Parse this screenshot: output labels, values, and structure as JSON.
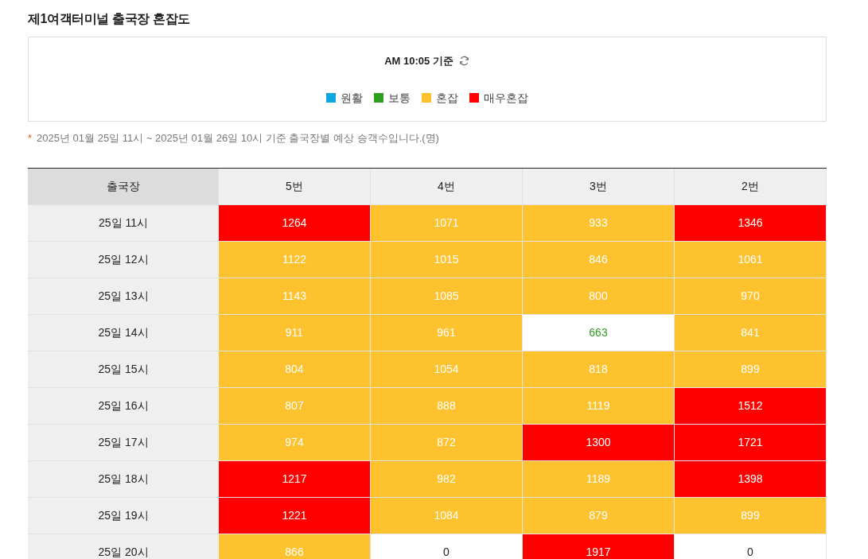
{
  "title": "제1여객터미널 출국장 혼잡도",
  "info_box": {
    "time": "AM 10:05 기준",
    "legend": [
      {
        "label": "원활",
        "color": "#0ea5e0"
      },
      {
        "label": "보통",
        "color": "#2e9e1f"
      },
      {
        "label": "혼잡",
        "color": "#fec22f"
      },
      {
        "label": "매우혼잡",
        "color": "#ff0000"
      }
    ]
  },
  "note_mark": "*",
  "note": "2025년 01월 25일 11시 ~ 2025년 01월 26일 10시 기준 출국장별 예상 승객수입니다.(명)",
  "table": {
    "columns": [
      "출국장",
      "5번",
      "4번",
      "3번",
      "2번"
    ],
    "rows": [
      {
        "cells": [
          {
            "value": "25일 11시",
            "kind": "label"
          },
          {
            "value": "1264",
            "kind": "fill",
            "color": "#ff0000"
          },
          {
            "value": "1071",
            "kind": "fill",
            "color": "#fec22f"
          },
          {
            "value": "933",
            "kind": "fill",
            "color": "#fec22f"
          },
          {
            "value": "1346",
            "kind": "fill",
            "color": "#ff0000"
          }
        ]
      },
      {
        "cells": [
          {
            "value": "25일 12시",
            "kind": "label"
          },
          {
            "value": "1122",
            "kind": "fill",
            "color": "#fec22f"
          },
          {
            "value": "1015",
            "kind": "fill",
            "color": "#fec22f"
          },
          {
            "value": "846",
            "kind": "fill",
            "color": "#fec22f"
          },
          {
            "value": "1061",
            "kind": "fill",
            "color": "#fec22f"
          }
        ]
      },
      {
        "cells": [
          {
            "value": "25일 13시",
            "kind": "label"
          },
          {
            "value": "1143",
            "kind": "fill",
            "color": "#fec22f"
          },
          {
            "value": "1085",
            "kind": "fill",
            "color": "#fec22f"
          },
          {
            "value": "800",
            "kind": "fill",
            "color": "#fec22f"
          },
          {
            "value": "970",
            "kind": "fill",
            "color": "#fec22f"
          }
        ]
      },
      {
        "cells": [
          {
            "value": "25일 14시",
            "kind": "label"
          },
          {
            "value": "911",
            "kind": "fill",
            "color": "#fec22f"
          },
          {
            "value": "961",
            "kind": "fill",
            "color": "#fec22f"
          },
          {
            "value": "663",
            "kind": "text",
            "color": "#2e9e1f"
          },
          {
            "value": "841",
            "kind": "fill",
            "color": "#fec22f"
          }
        ]
      },
      {
        "cells": [
          {
            "value": "25일 15시",
            "kind": "label"
          },
          {
            "value": "804",
            "kind": "fill",
            "color": "#fec22f"
          },
          {
            "value": "1054",
            "kind": "fill",
            "color": "#fec22f"
          },
          {
            "value": "818",
            "kind": "fill",
            "color": "#fec22f"
          },
          {
            "value": "899",
            "kind": "fill",
            "color": "#fec22f"
          }
        ]
      },
      {
        "cells": [
          {
            "value": "25일 16시",
            "kind": "label"
          },
          {
            "value": "807",
            "kind": "fill",
            "color": "#fec22f"
          },
          {
            "value": "888",
            "kind": "fill",
            "color": "#fec22f"
          },
          {
            "value": "1119",
            "kind": "fill",
            "color": "#fec22f"
          },
          {
            "value": "1512",
            "kind": "fill",
            "color": "#ff0000"
          }
        ]
      },
      {
        "cells": [
          {
            "value": "25일 17시",
            "kind": "label"
          },
          {
            "value": "974",
            "kind": "fill",
            "color": "#fec22f"
          },
          {
            "value": "872",
            "kind": "fill",
            "color": "#fec22f"
          },
          {
            "value": "1300",
            "kind": "fill",
            "color": "#ff0000"
          },
          {
            "value": "1721",
            "kind": "fill",
            "color": "#ff0000"
          }
        ]
      },
      {
        "cells": [
          {
            "value": "25일 18시",
            "kind": "label"
          },
          {
            "value": "1217",
            "kind": "fill",
            "color": "#ff0000"
          },
          {
            "value": "982",
            "kind": "fill",
            "color": "#fec22f"
          },
          {
            "value": "1189",
            "kind": "fill",
            "color": "#fec22f"
          },
          {
            "value": "1398",
            "kind": "fill",
            "color": "#ff0000"
          }
        ]
      },
      {
        "cells": [
          {
            "value": "25일 19시",
            "kind": "label"
          },
          {
            "value": "1221",
            "kind": "fill",
            "color": "#ff0000"
          },
          {
            "value": "1084",
            "kind": "fill",
            "color": "#fec22f"
          },
          {
            "value": "879",
            "kind": "fill",
            "color": "#fec22f"
          },
          {
            "value": "899",
            "kind": "fill",
            "color": "#fec22f"
          }
        ]
      },
      {
        "cells": [
          {
            "value": "25일 20시",
            "kind": "label"
          },
          {
            "value": "866",
            "kind": "fill",
            "color": "#fec22f"
          },
          {
            "value": "0",
            "kind": "text",
            "color": "#222222"
          },
          {
            "value": "1917",
            "kind": "fill",
            "color": "#ff0000"
          },
          {
            "value": "0",
            "kind": "text",
            "color": "#222222"
          }
        ]
      }
    ]
  }
}
